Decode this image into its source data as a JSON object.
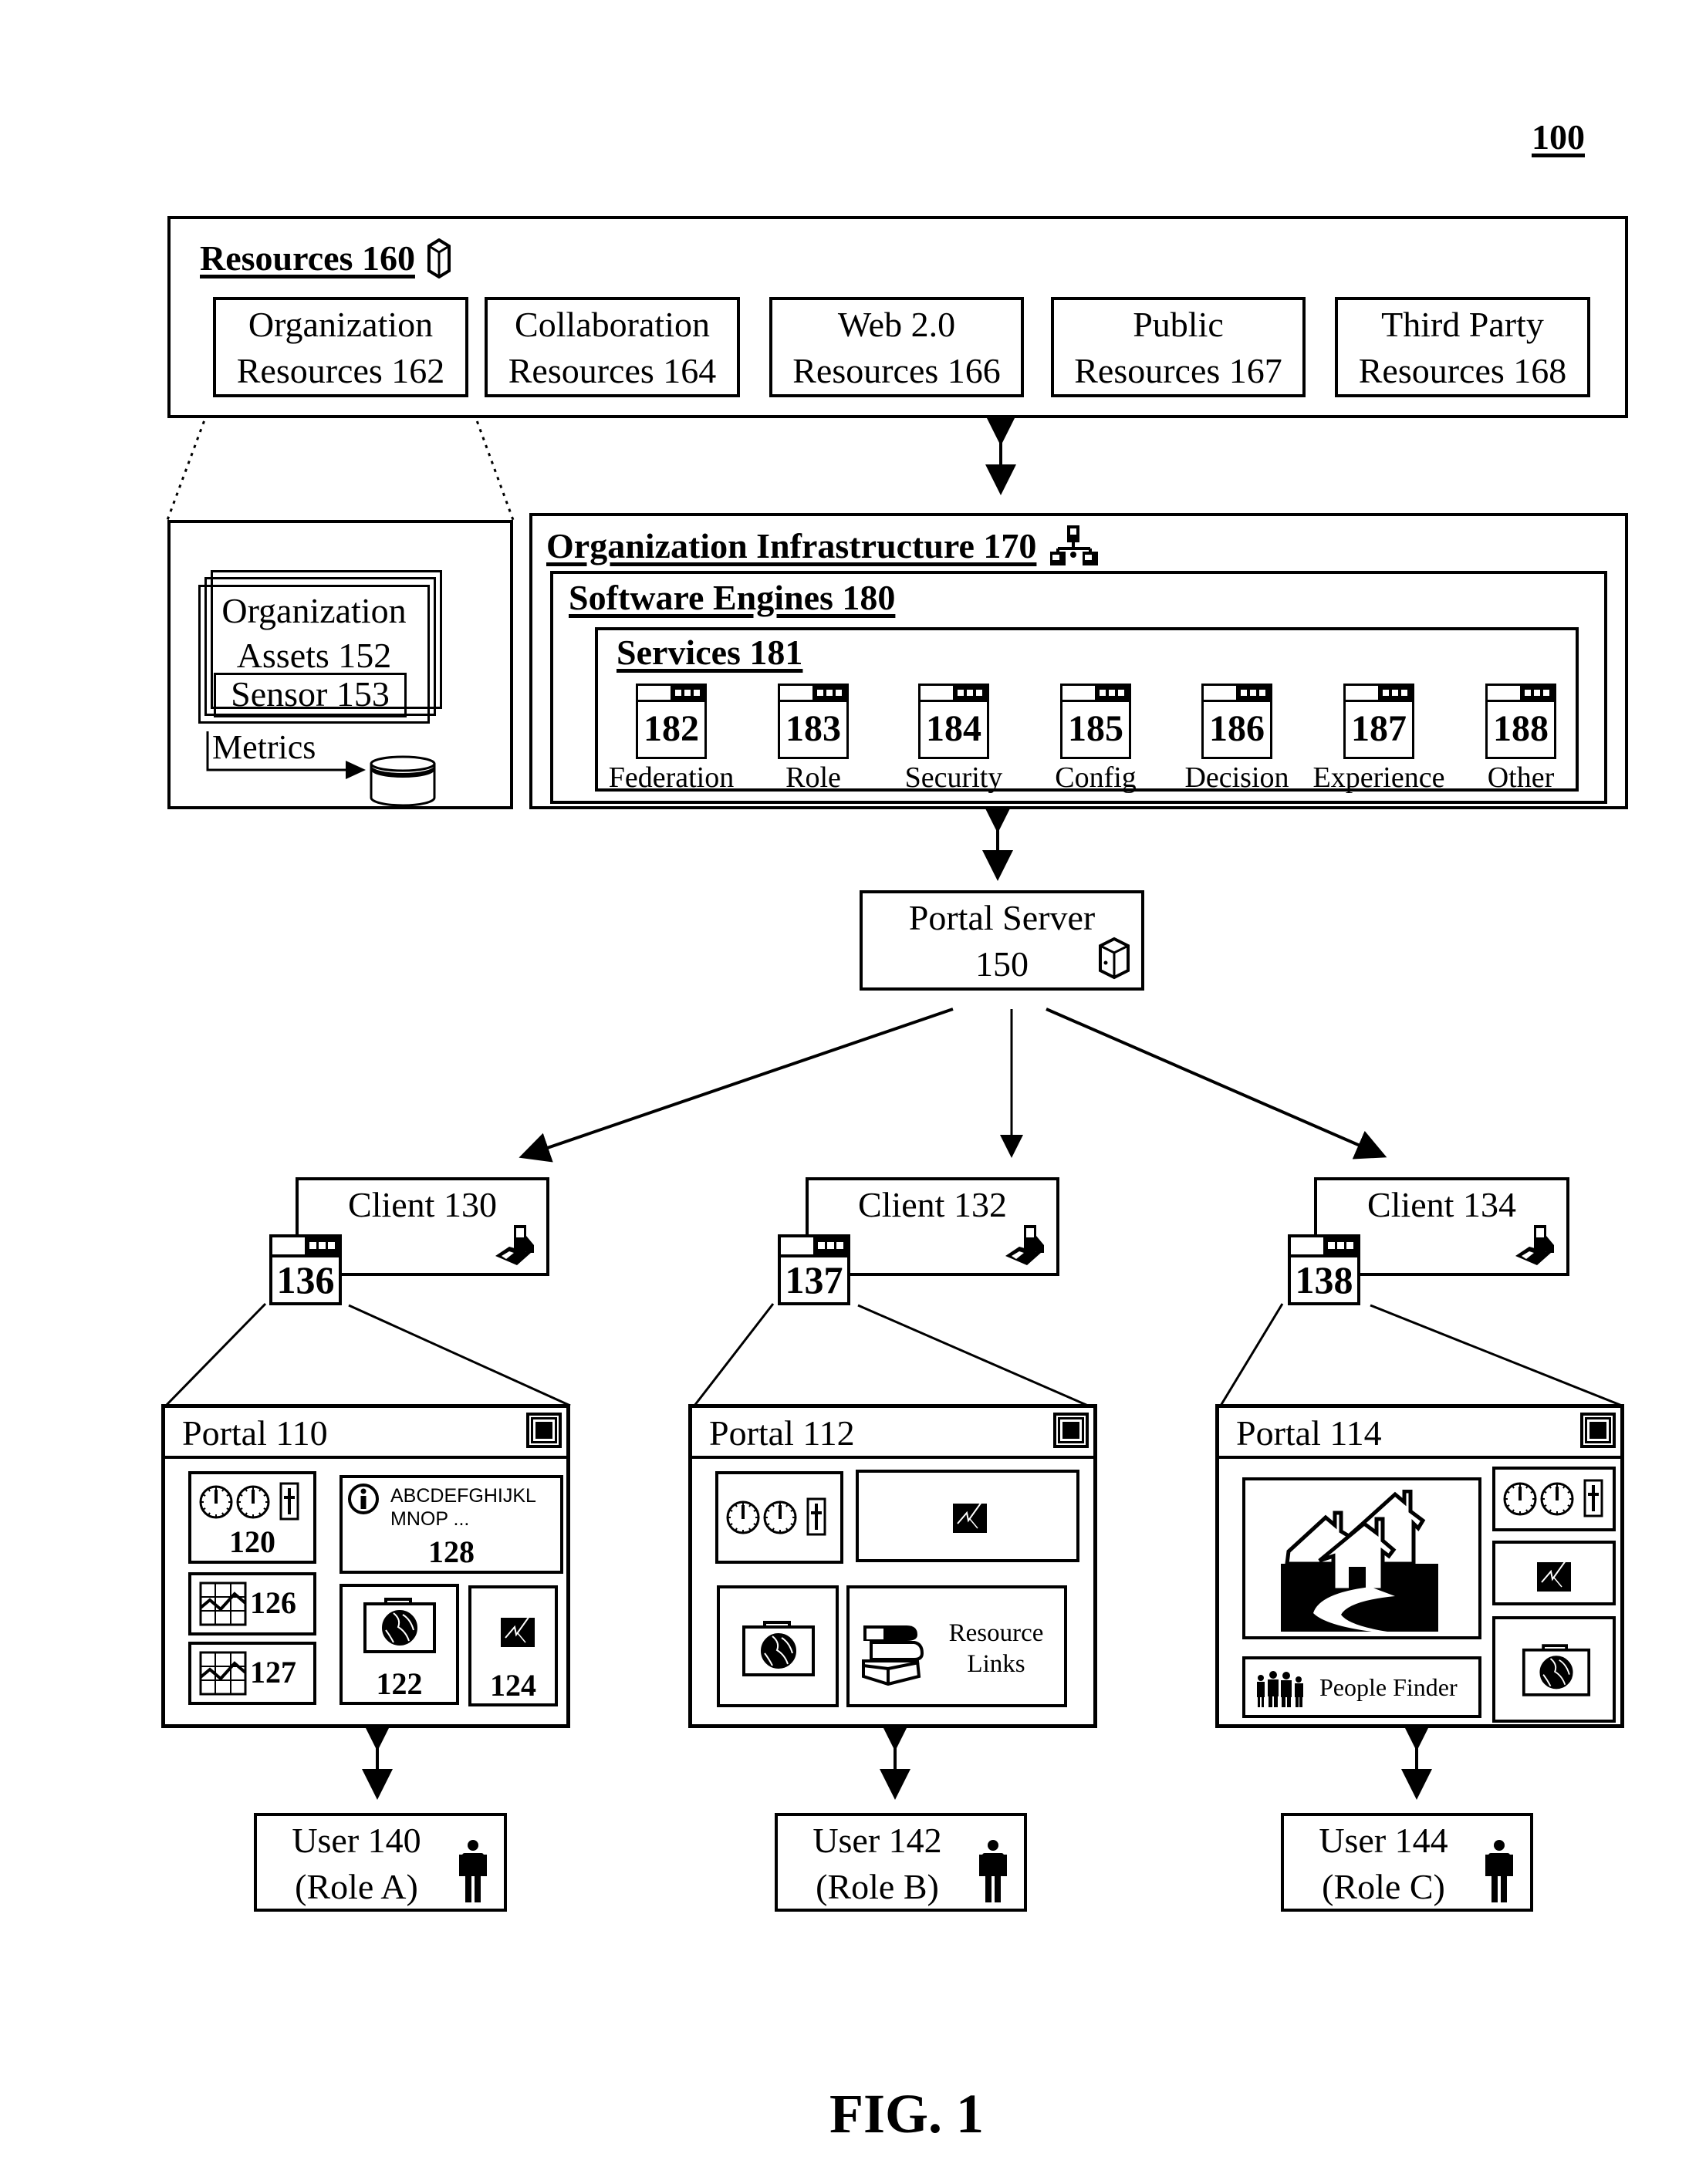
{
  "figure": {
    "ref_number": "100",
    "caption": "FIG. 1"
  },
  "resources": {
    "title": "Resources 160",
    "icon": "server-icon",
    "items": [
      {
        "line1": "Organization",
        "line2": "Resources 162"
      },
      {
        "line1": "Collaboration",
        "line2": "Resources 164"
      },
      {
        "line1": "Web 2.0",
        "line2": "Resources 166"
      },
      {
        "line1": "Public",
        "line2": "Resources 167"
      },
      {
        "line1": "Third Party",
        "line2": "Resources 168"
      }
    ]
  },
  "assets": {
    "line1": "Organization",
    "line2": "Assets 152",
    "sensor": "Sensor 153",
    "metrics": "Metrics",
    "db_icon": "database-icon"
  },
  "infrastructure": {
    "title": "Organization Infrastructure 170",
    "icon": "network-icon",
    "engines_title": "Software Engines 180",
    "services_title": "Services 181",
    "services": [
      {
        "number": "182",
        "name": "Federation"
      },
      {
        "number": "183",
        "name": "Role"
      },
      {
        "number": "184",
        "name": "Security"
      },
      {
        "number": "185",
        "name": "Config"
      },
      {
        "number": "186",
        "name": "Decision"
      },
      {
        "number": "187",
        "name": "Experience"
      },
      {
        "number": "188",
        "name": "Other"
      }
    ]
  },
  "portal_server": {
    "line1": "Portal Server",
    "line2": "150",
    "icon": "server-icon"
  },
  "clients": [
    {
      "label": "Client 130",
      "window_number": "136",
      "icon": "computer-icon"
    },
    {
      "label": "Client 132",
      "window_number": "137",
      "icon": "computer-icon"
    },
    {
      "label": "Client 134",
      "window_number": "138",
      "icon": "computer-icon"
    }
  ],
  "portals": [
    {
      "title": "Portal 110",
      "panels": {
        "gauges": "120",
        "info_text_line1": "ABCDEFGHIJKL",
        "info_text_line2": "MNOP ...",
        "info": "128",
        "chart_a": "126",
        "chart_b": "127",
        "globe": "122",
        "report": "124"
      }
    },
    {
      "title": "Portal 112",
      "panels": {
        "resource_links_line1": "Resource",
        "resource_links_line2": "Links"
      }
    },
    {
      "title": "Portal 114",
      "panels": {
        "people_finder": "People Finder"
      }
    }
  ],
  "users": [
    {
      "line1": "User 140",
      "line2": "(Role A)",
      "icon": "person-icon"
    },
    {
      "line1": "User 142",
      "line2": "(Role B)",
      "icon": "person-icon"
    },
    {
      "line1": "User 144",
      "line2": "(Role C)",
      "icon": "person-icon"
    }
  ]
}
